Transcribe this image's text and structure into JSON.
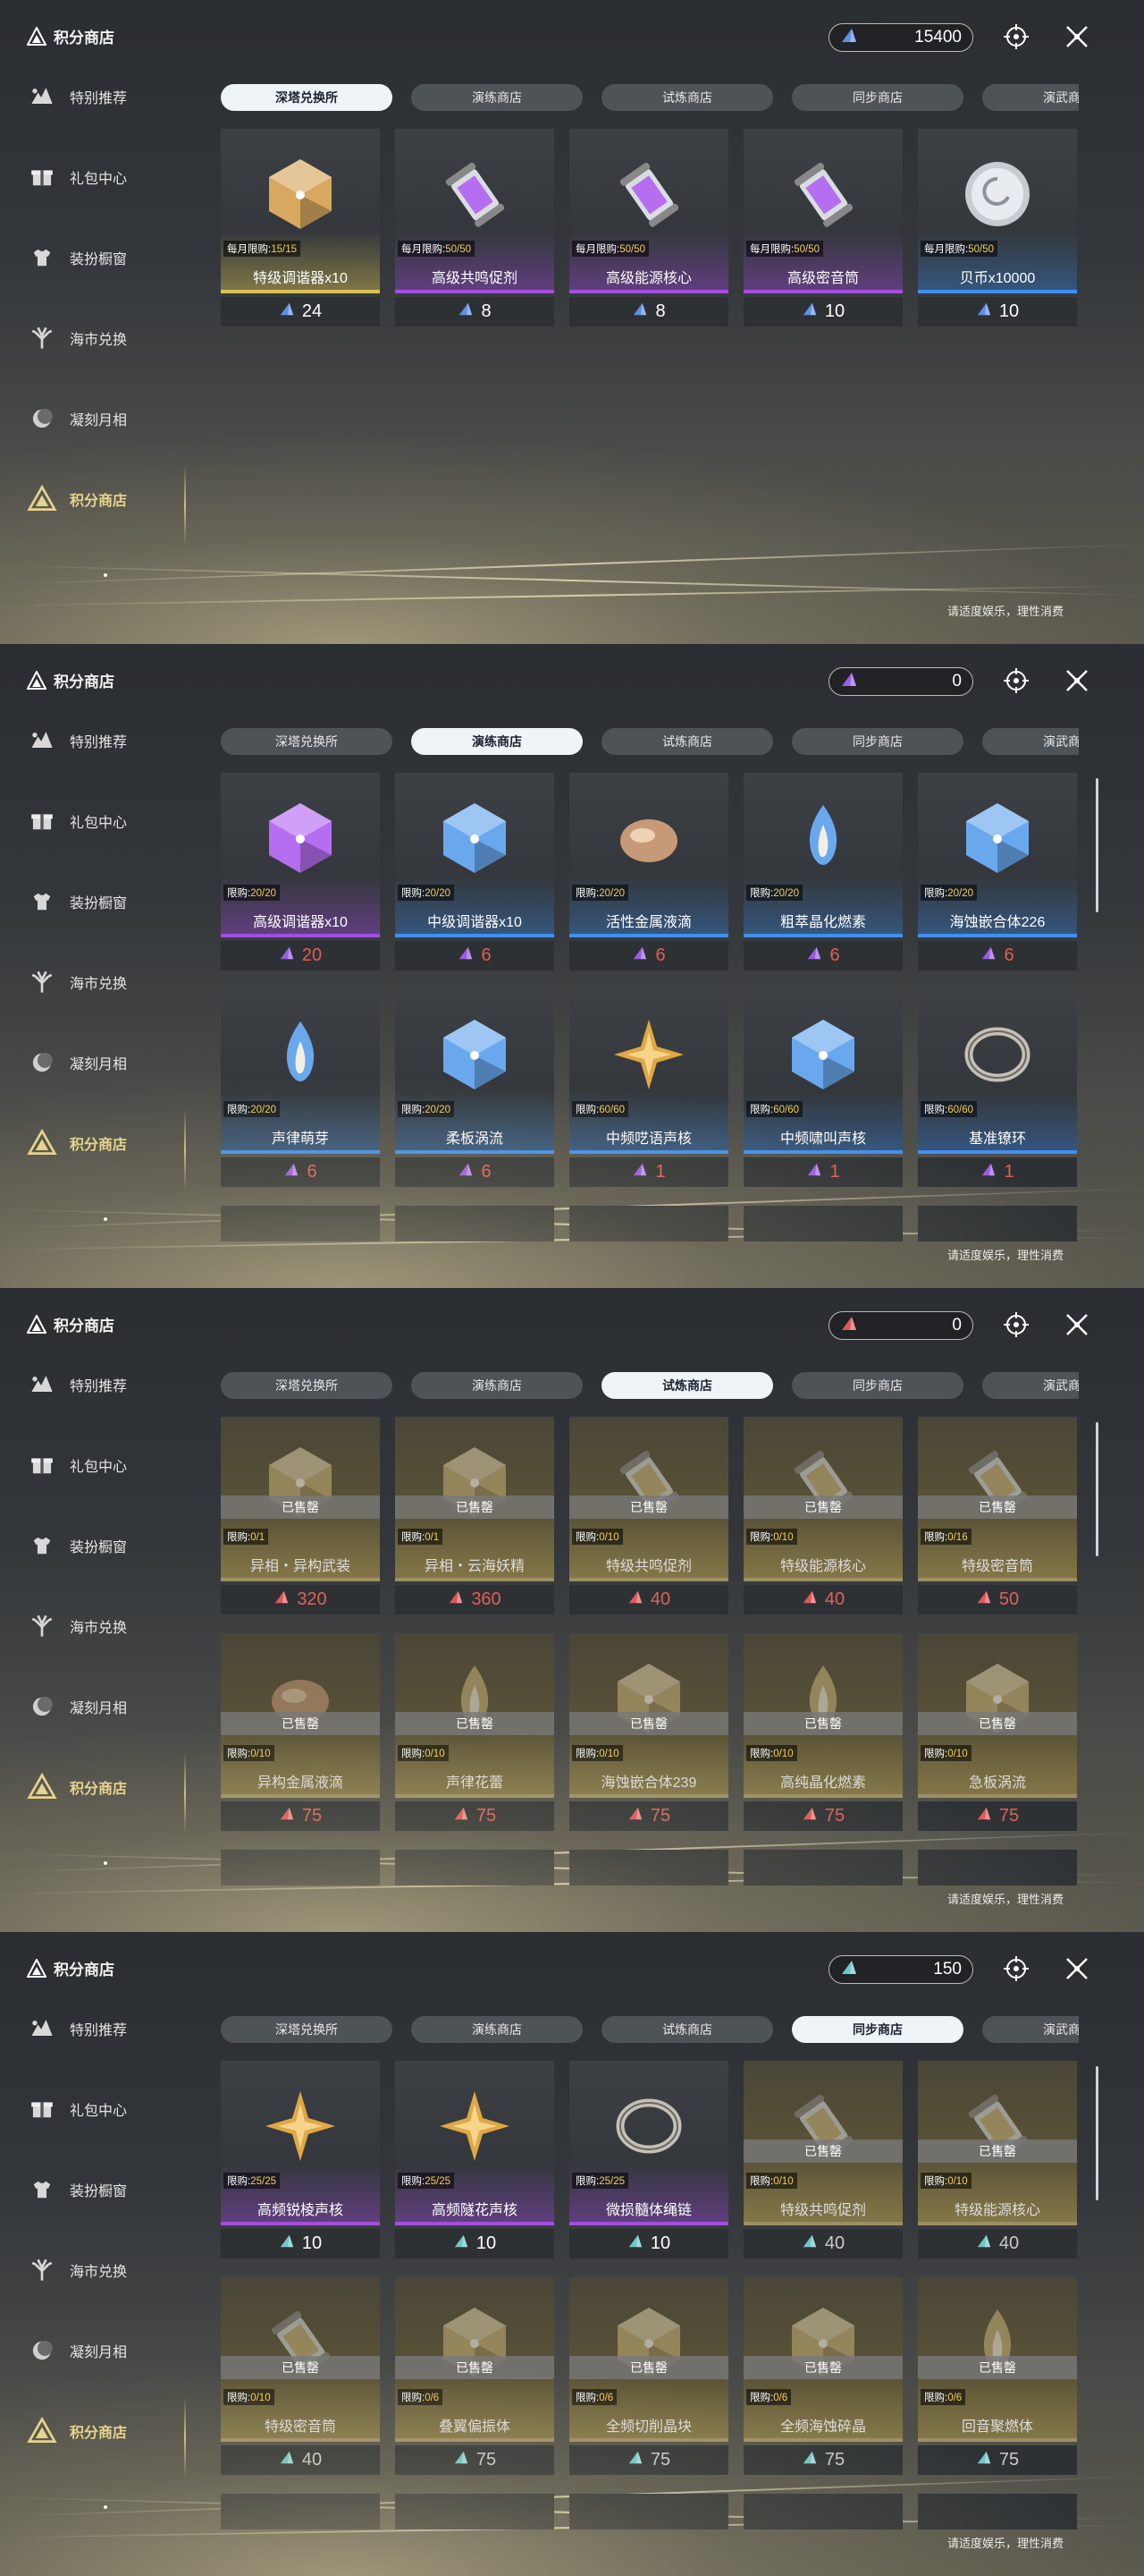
{
  "colors": {
    "gold": "#f3cf5b",
    "purple": "#a34ee0",
    "blue": "#3f8ff0",
    "yellow": "#d9c256",
    "red_price": "#e85a52",
    "teal": "#48c0d0"
  },
  "screens": [
    {
      "title": "积分商店",
      "currency": {
        "icon": "blue-crystal-icon",
        "amount": "15400"
      },
      "nav": [
        "特别推荐",
        "礼包中心",
        "装扮橱窗",
        "海市兑换",
        "凝刻月相",
        "积分商店"
      ],
      "tabs": [
        "深塔兑换所",
        "演练商店",
        "试炼商店",
        "同步商店",
        "演武商店"
      ],
      "active_tab": 0,
      "footnote": "请适度娱乐，理性消费",
      "items": [
        {
          "limit_label": "每月限购:",
          "limit": "15/15",
          "name": "特级调谐器x10",
          "price": "24",
          "icon": "tuner-gold-icon",
          "rarity": "yellow"
        },
        {
          "limit_label": "每月限购:",
          "limit": "50/50",
          "name": "高级共鸣促剂",
          "price": "8",
          "icon": "vial-icon",
          "rarity": "purple"
        },
        {
          "limit_label": "每月限购:",
          "limit": "50/50",
          "name": "高级能源核心",
          "price": "8",
          "icon": "energy-core-icon",
          "rarity": "purple"
        },
        {
          "limit_label": "每月限购:",
          "limit": "50/50",
          "name": "高级密音筒",
          "price": "10",
          "icon": "sound-cylinder-icon",
          "rarity": "purple"
        },
        {
          "limit_label": "每月限购:",
          "limit": "50/50",
          "name": "贝币x10000",
          "price": "10",
          "icon": "coin-icon",
          "rarity": "blue"
        }
      ]
    },
    {
      "title": "积分商店",
      "currency": {
        "icon": "purple-crystal-icon",
        "amount": "0"
      },
      "nav": [
        "特别推荐",
        "礼包中心",
        "装扮橱窗",
        "海市兑换",
        "凝刻月相",
        "积分商店"
      ],
      "tabs": [
        "深塔兑换所",
        "演练商店",
        "试炼商店",
        "同步商店",
        "演武商店"
      ],
      "active_tab": 1,
      "footnote": "请适度娱乐，理性消费",
      "items": [
        {
          "limit_label": "限购:",
          "limit": "20/20",
          "name": "高级调谐器x10",
          "price": "20",
          "icon": "tuner-purple-icon",
          "rarity": "purple"
        },
        {
          "limit_label": "限购:",
          "limit": "20/20",
          "name": "中级调谐器x10",
          "price": "6",
          "icon": "tuner-blue-icon",
          "rarity": "blue"
        },
        {
          "limit_label": "限购:",
          "limit": "20/20",
          "name": "活性金属液滴",
          "price": "6",
          "icon": "metal-drop-icon",
          "rarity": "blue"
        },
        {
          "limit_label": "限购:",
          "limit": "20/20",
          "name": "粗萃晶化燃素",
          "price": "6",
          "icon": "crystal-flame-icon",
          "rarity": "blue"
        },
        {
          "limit_label": "限购:",
          "limit": "20/20",
          "name": "海蚀嵌合体226",
          "price": "6",
          "icon": "chimera-icon",
          "rarity": "blue"
        },
        {
          "limit_label": "限购:",
          "limit": "20/20",
          "name": "声律萌芽",
          "price": "6",
          "icon": "sprout-icon",
          "rarity": "blue"
        },
        {
          "limit_label": "限购:",
          "limit": "20/20",
          "name": "柔板涡流",
          "price": "6",
          "icon": "vortex-icon",
          "rarity": "blue"
        },
        {
          "limit_label": "限购:",
          "limit": "60/60",
          "name": "中频呓语声核",
          "price": "1",
          "icon": "star-core-icon",
          "rarity": "blue"
        },
        {
          "limit_label": "限购:",
          "limit": "60/60",
          "name": "中频啸叫声核",
          "price": "1",
          "icon": "howl-core-icon",
          "rarity": "blue"
        },
        {
          "limit_label": "限购:",
          "limit": "60/60",
          "name": "基准镣环",
          "price": "1",
          "icon": "ring-icon",
          "rarity": "blue"
        }
      ]
    },
    {
      "title": "积分商店",
      "currency": {
        "icon": "red-crystal-icon",
        "amount": "0"
      },
      "nav": [
        "特别推荐",
        "礼包中心",
        "装扮橱窗",
        "海市兑换",
        "凝刻月相",
        "积分商店"
      ],
      "tabs": [
        "深塔兑换所",
        "演练商店",
        "试炼商店",
        "同步商店",
        "演武商店"
      ],
      "active_tab": 2,
      "footnote": "请适度娱乐，理性消费",
      "sold_label": "已售罄",
      "items": [
        {
          "limit_label": "限购:",
          "limit": "0/1",
          "name": "异相・异构武装",
          "price": "320",
          "icon": "armor-icon",
          "sold": true
        },
        {
          "limit_label": "限购:",
          "limit": "0/1",
          "name": "异相・云海妖精",
          "price": "360",
          "icon": "fairy-icon",
          "sold": true
        },
        {
          "limit_label": "限购:",
          "limit": "0/10",
          "name": "特级共鸣促剂",
          "price": "40",
          "icon": "vial-icon",
          "sold": true
        },
        {
          "limit_label": "限购:",
          "limit": "0/10",
          "name": "特级能源核心",
          "price": "40",
          "icon": "energy-core-icon",
          "sold": true
        },
        {
          "limit_label": "限购:",
          "limit": "0/16",
          "name": "特级密音筒",
          "price": "50",
          "icon": "sound-cylinder-icon",
          "sold": true
        },
        {
          "limit_label": "限购:",
          "limit": "0/10",
          "name": "异构金属液滴",
          "price": "75",
          "icon": "metal-drop-icon",
          "sold": true
        },
        {
          "limit_label": "限购:",
          "limit": "0/10",
          "name": "声律花蕾",
          "price": "75",
          "icon": "bud-icon",
          "sold": true
        },
        {
          "limit_label": "限购:",
          "limit": "0/10",
          "name": "海蚀嵌合体239",
          "price": "75",
          "icon": "chimera-icon",
          "sold": true
        },
        {
          "limit_label": "限购:",
          "limit": "0/10",
          "name": "高纯晶化燃素",
          "price": "75",
          "icon": "crystal-flame-icon",
          "sold": true
        },
        {
          "limit_label": "限购:",
          "limit": "0/10",
          "name": "急板涡流",
          "price": "75",
          "icon": "vortex-icon",
          "sold": true
        }
      ]
    },
    {
      "title": "积分商店",
      "currency": {
        "icon": "teal-crystal-icon",
        "amount": "150"
      },
      "nav": [
        "特别推荐",
        "礼包中心",
        "装扮橱窗",
        "海市兑换",
        "凝刻月相",
        "积分商店"
      ],
      "tabs": [
        "深塔兑换所",
        "演练商店",
        "试炼商店",
        "同步商店",
        "演武商店"
      ],
      "active_tab": 3,
      "footnote": "请适度娱乐，理性消费",
      "sold_label": "已售罄",
      "items": [
        {
          "limit_label": "限购:",
          "limit": "25/25",
          "name": "高频锐棱声核",
          "price": "10",
          "icon": "prism-core-icon",
          "rarity": "purple"
        },
        {
          "limit_label": "限购:",
          "limit": "25/25",
          "name": "高频隧花声核",
          "price": "10",
          "icon": "flower-core-icon",
          "rarity": "purple"
        },
        {
          "limit_label": "限购:",
          "limit": "25/25",
          "name": "微损髓体绳链",
          "price": "10",
          "icon": "chain-icon",
          "rarity": "purple"
        },
        {
          "limit_label": "限购:",
          "limit": "0/10",
          "name": "特级共鸣促剂",
          "price": "40",
          "icon": "vial-icon",
          "sold": true
        },
        {
          "limit_label": "限购:",
          "limit": "0/10",
          "name": "特级能源核心",
          "price": "40",
          "icon": "energy-core-icon",
          "sold": true
        },
        {
          "limit_label": "限购:",
          "limit": "0/10",
          "name": "特级密音筒",
          "price": "40",
          "icon": "sound-cylinder-icon",
          "sold": true
        },
        {
          "limit_label": "限购:",
          "limit": "0/6",
          "name": "叠翼偏振体",
          "price": "75",
          "icon": "wing-icon",
          "sold": true
        },
        {
          "limit_label": "限购:",
          "limit": "0/6",
          "name": "全频切削晶块",
          "price": "75",
          "icon": "cube-icon",
          "sold": true
        },
        {
          "limit_label": "限购:",
          "limit": "0/6",
          "name": "全频海蚀碎晶",
          "price": "75",
          "icon": "shard-icon",
          "sold": true
        },
        {
          "limit_label": "限购:",
          "limit": "0/6",
          "name": "回音聚燃体",
          "price": "75",
          "icon": "flame-icon",
          "sold": true
        }
      ]
    }
  ]
}
